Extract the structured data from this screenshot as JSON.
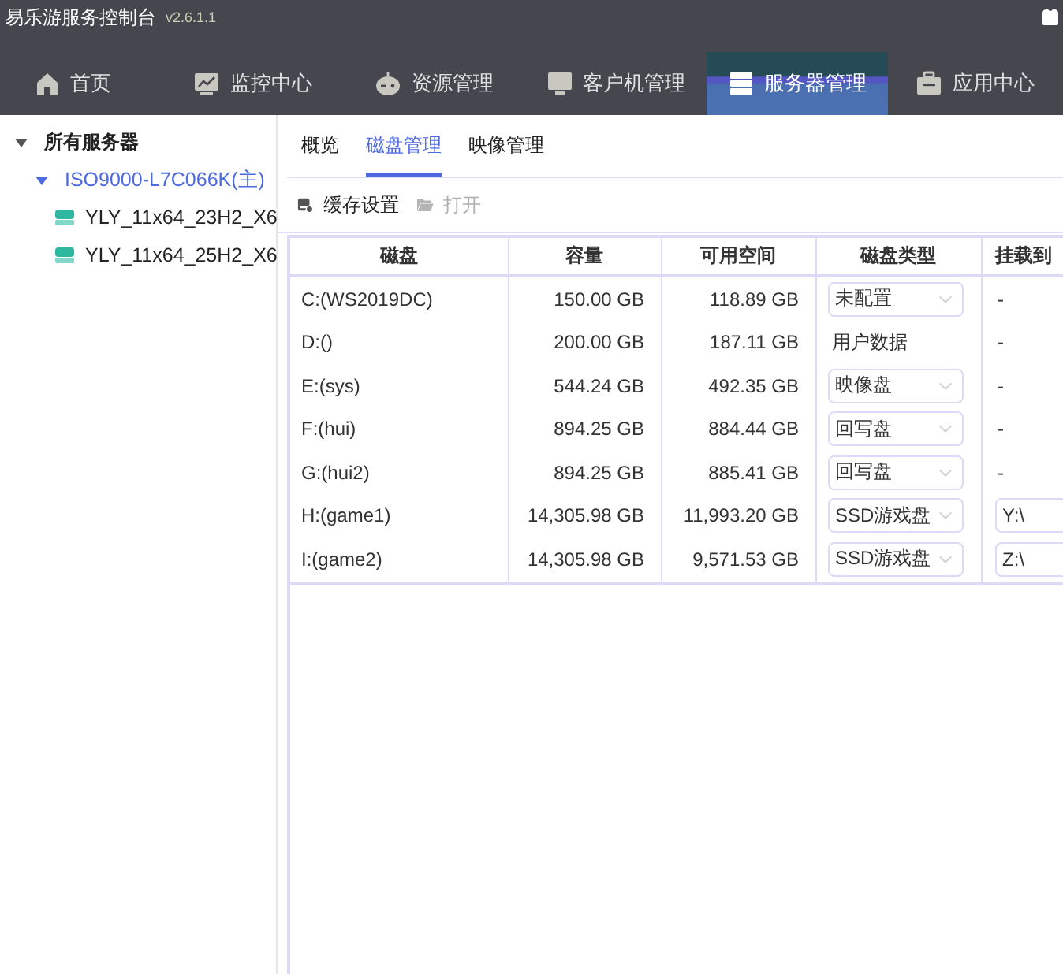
{
  "window": {
    "title": "易乐游服务控制台",
    "version": "v2.6.1.1"
  },
  "nav": [
    {
      "label": "首页",
      "selected": false
    },
    {
      "label": "监控中心",
      "selected": false
    },
    {
      "label": "资源管理",
      "selected": false
    },
    {
      "label": "客户机管理",
      "selected": false
    },
    {
      "label": "服务器管理",
      "selected": true
    },
    {
      "label": "应用中心",
      "selected": false
    }
  ],
  "sidebar": {
    "tree": [
      {
        "label": "所有服务器",
        "expanded": true,
        "selected": false,
        "children": [
          {
            "label": "ISO9000-L7C066K(主)",
            "expanded": true,
            "selected": true,
            "children": [
              {
                "label": "YLY_11x64_23H2_X6",
                "selected": false
              },
              {
                "label": "YLY_11x64_25H2_X6",
                "selected": false
              }
            ]
          }
        ]
      }
    ]
  },
  "tabs": [
    {
      "label": "概览",
      "selected": false
    },
    {
      "label": "磁盘管理",
      "selected": true
    },
    {
      "label": "映像管理",
      "selected": false
    }
  ],
  "toolbar": [
    {
      "label": "缓存设置",
      "disabled": false
    },
    {
      "label": "打开",
      "disabled": true
    }
  ],
  "table": {
    "columns": [
      "磁盘",
      "容量",
      "可用空间",
      "磁盘类型",
      "挂载到"
    ],
    "rows": [
      {
        "disk": "C:(WS2019DC)",
        "capacity": "150.00 GB",
        "free": "118.89 GB",
        "type": {
          "kind": "select",
          "value": "未配置"
        },
        "mount": {
          "kind": "text",
          "value": "-"
        }
      },
      {
        "disk": "D:()",
        "capacity": "200.00 GB",
        "free": "187.11 GB",
        "type": {
          "kind": "text",
          "value": "用户数据"
        },
        "mount": {
          "kind": "text",
          "value": "-"
        }
      },
      {
        "disk": "E:(sys)",
        "capacity": "544.24 GB",
        "free": "492.35 GB",
        "type": {
          "kind": "select",
          "value": "映像盘"
        },
        "mount": {
          "kind": "text",
          "value": "-"
        }
      },
      {
        "disk": "F:(hui)",
        "capacity": "894.25 GB",
        "free": "884.44 GB",
        "type": {
          "kind": "select",
          "value": "回写盘"
        },
        "mount": {
          "kind": "text",
          "value": "-"
        }
      },
      {
        "disk": "G:(hui2)",
        "capacity": "894.25 GB",
        "free": "885.41 GB",
        "type": {
          "kind": "select",
          "value": "回写盘"
        },
        "mount": {
          "kind": "text",
          "value": "-"
        }
      },
      {
        "disk": "H:(game1)",
        "capacity": "14,305.98 GB",
        "free": "11,993.20 GB",
        "type": {
          "kind": "select",
          "value": "SSD游戏盘"
        },
        "mount": {
          "kind": "input",
          "value": "Y:\\"
        }
      },
      {
        "disk": "I:(game2)",
        "capacity": "14,305.98 GB",
        "free": "9,571.53 GB",
        "type": {
          "kind": "select",
          "value": "SSD游戏盘"
        },
        "mount": {
          "kind": "input",
          "value": "Z:\\"
        }
      }
    ]
  }
}
